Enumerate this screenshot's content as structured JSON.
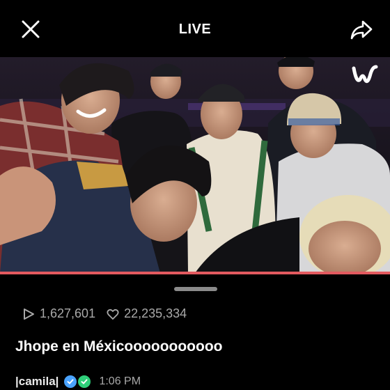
{
  "header": {
    "title": "LIVE"
  },
  "video": {
    "logo_text": "w"
  },
  "stats": {
    "plays": "1,627,601",
    "likes": "22,235,334"
  },
  "post": {
    "title": "Jhope en Méxicooooooooooo"
  },
  "author": {
    "name": "|camila|",
    "time": "1:06 PM"
  },
  "colors": {
    "progress": "#e35a5f",
    "badge_blue": "#4aa3ff",
    "badge_green": "#2fcf7a"
  },
  "icons": [
    "close-icon",
    "share-icon",
    "weverse-logo",
    "play-icon",
    "heart-icon",
    "verified-badge-icon",
    "check-badge-icon"
  ]
}
